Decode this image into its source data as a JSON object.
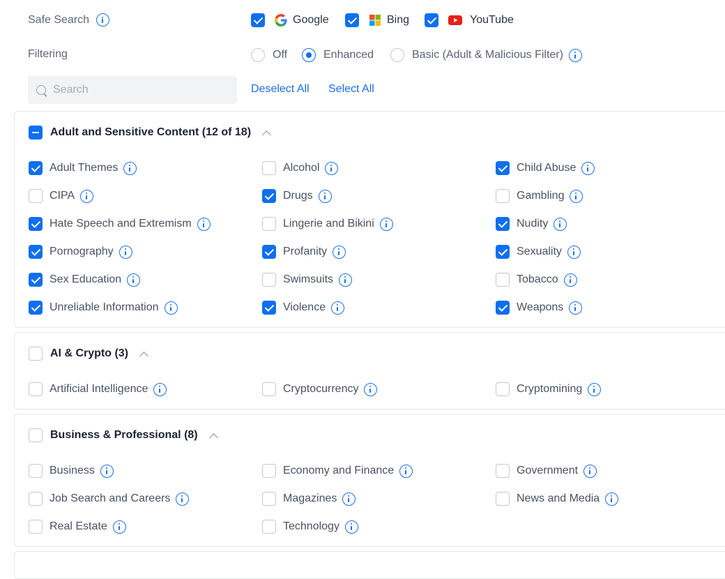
{
  "safe_search": {
    "label": "Safe Search",
    "engines": [
      {
        "name": "Google",
        "checked": true,
        "icon": "google-icon"
      },
      {
        "name": "Bing",
        "checked": true,
        "icon": "bing-icon"
      },
      {
        "name": "YouTube",
        "checked": true,
        "icon": "youtube-icon"
      }
    ]
  },
  "filtering": {
    "label": "Filtering",
    "options": [
      "Off",
      "Enhanced",
      "Basic (Adult & Malicious Filter)"
    ],
    "selected": "Enhanced"
  },
  "search": {
    "placeholder": "Search",
    "value": ""
  },
  "actions": {
    "deselect_all": "Deselect All",
    "select_all": "Select All"
  },
  "colors": {
    "accent": "#0e6ff0",
    "border": "#e6e8ec",
    "google_red": "#ea4335",
    "youtube_red": "#e62117"
  },
  "sections": [
    {
      "title": "Adult and Sensitive Content (12 of 18)",
      "state": "partial",
      "items": [
        {
          "label": "Adult Themes",
          "checked": true
        },
        {
          "label": "Alcohol",
          "checked": false
        },
        {
          "label": "Child Abuse",
          "checked": true
        },
        {
          "label": "CIPA",
          "checked": false
        },
        {
          "label": "Drugs",
          "checked": true
        },
        {
          "label": "Gambling",
          "checked": false
        },
        {
          "label": "Hate Speech and Extremism",
          "checked": true
        },
        {
          "label": "Lingerie and Bikini",
          "checked": false
        },
        {
          "label": "Nudity",
          "checked": true
        },
        {
          "label": "Pornography",
          "checked": true
        },
        {
          "label": "Profanity",
          "checked": true
        },
        {
          "label": "Sexuality",
          "checked": true
        },
        {
          "label": "Sex Education",
          "checked": true
        },
        {
          "label": "Swimsuits",
          "checked": false
        },
        {
          "label": "Tobacco",
          "checked": false
        },
        {
          "label": "Unreliable Information",
          "checked": true
        },
        {
          "label": "Violence",
          "checked": true
        },
        {
          "label": "Weapons",
          "checked": true
        }
      ]
    },
    {
      "title": "AI & Crypto (3)",
      "state": "unchecked",
      "items": [
        {
          "label": "Artificial Intelligence",
          "checked": false
        },
        {
          "label": "Cryptocurrency",
          "checked": false
        },
        {
          "label": "Cryptomining",
          "checked": false
        }
      ]
    },
    {
      "title": "Business & Professional (8)",
      "state": "unchecked",
      "items": [
        {
          "label": "Business",
          "checked": false
        },
        {
          "label": "Economy and Finance",
          "checked": false
        },
        {
          "label": "Government",
          "checked": false
        },
        {
          "label": "Job Search and Careers",
          "checked": false
        },
        {
          "label": "Magazines",
          "checked": false
        },
        {
          "label": "News and Media",
          "checked": false
        },
        {
          "label": "Real Estate",
          "checked": false
        },
        {
          "label": "Technology",
          "checked": false
        }
      ]
    }
  ]
}
